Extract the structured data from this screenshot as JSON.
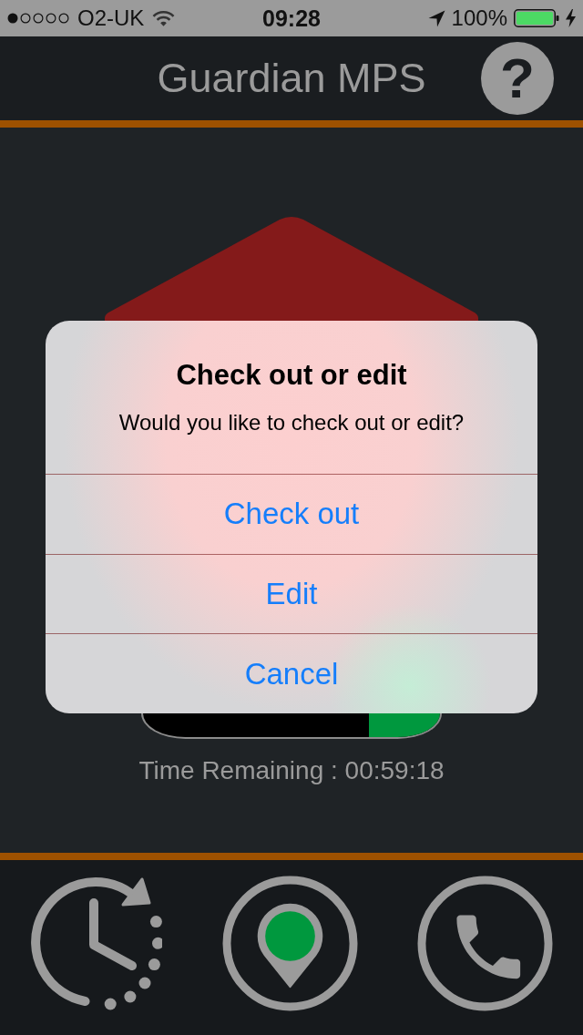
{
  "status_bar": {
    "carrier": "O2-UK",
    "time": "09:28",
    "battery": "100%"
  },
  "nav_bar": {
    "title": "Guardian MPS",
    "help_button": "?"
  },
  "main": {
    "progress": {
      "level": 0.24
    },
    "time_remaining": "Time Remaining : 00:59:18"
  },
  "alert": {
    "title": "Check out or edit",
    "message": "Would you like to check out or edit?",
    "buttons": [
      {
        "label": "Check out"
      },
      {
        "label": "Edit"
      },
      {
        "label": "Cancel"
      }
    ]
  }
}
